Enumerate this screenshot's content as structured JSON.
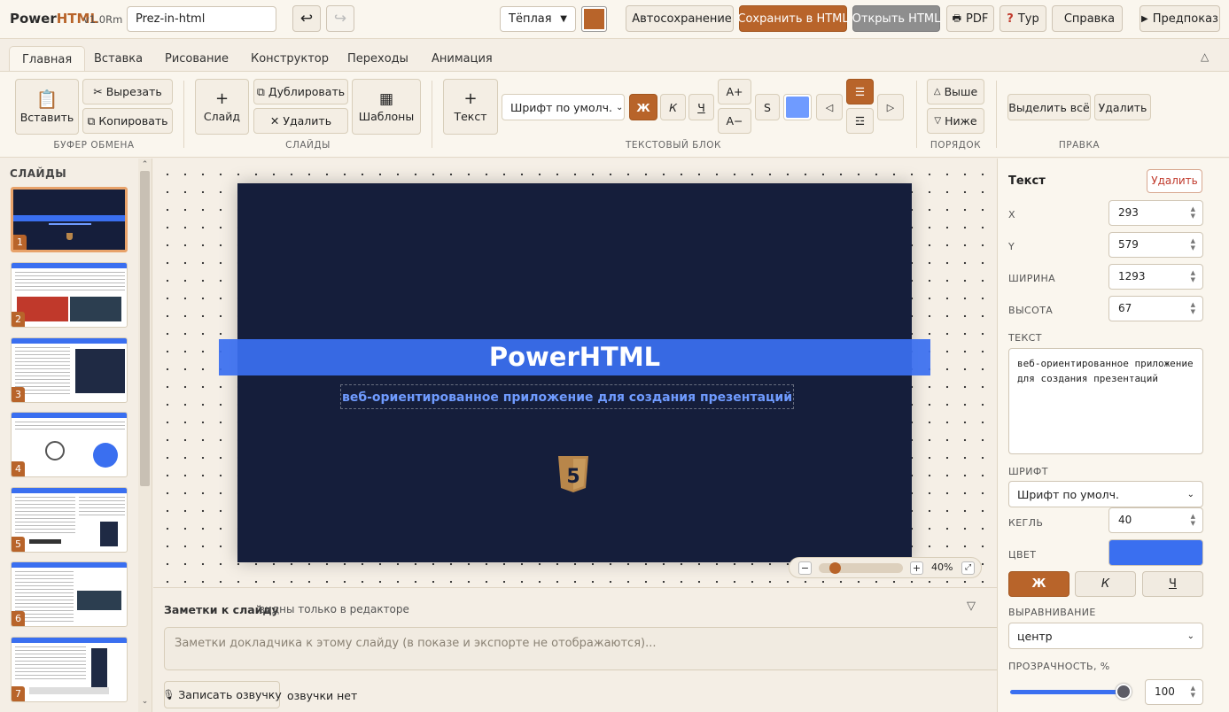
{
  "app": {
    "brand_a": "Power",
    "brand_b": "HTML",
    "version": "v1.0Rm",
    "file_name": "Prez-in-html"
  },
  "toolbar": {
    "theme": "Тёплая",
    "accent_color": "#b8642a",
    "autosave": "Автосохранение",
    "save_html": "Сохранить в HTML",
    "open_html": "Открыть HTML",
    "pdf": "PDF",
    "tour": "Тур",
    "help": "Справка",
    "preview": "Предпоказ"
  },
  "tabs": [
    "Главная",
    "Вставка",
    "Рисование",
    "Конструктор",
    "Переходы",
    "Анимация"
  ],
  "ribbon": {
    "paste": "Вставить",
    "cut": "Вырезать",
    "copy": "Копировать",
    "group_clipboard": "БУФЕР ОБМЕНА",
    "slide": "Слайд",
    "duplicate": "Дублировать",
    "delete": "Удалить",
    "templates": "Шаблоны",
    "group_slides": "СЛАЙДЫ",
    "text": "Текст",
    "font_select": "Шрифт по умолч.",
    "bold": "Ж",
    "italic": "К",
    "underline": "Ч",
    "font_up": "A+",
    "font_down": "A−",
    "strike": "S",
    "group_text": "ТЕКСТОВЫЙ БЛОК",
    "up": "Выше",
    "down": "Ниже",
    "group_order": "ПОРЯДОК",
    "select_all": "Выделить всё",
    "delete_sel": "Удалить",
    "group_edit": "ПРАВКА"
  },
  "slides_panel": {
    "title": "СЛАЙДЫ",
    "count_numbers": [
      "1",
      "2",
      "3",
      "4",
      "5",
      "6",
      "7"
    ]
  },
  "slide": {
    "title": "PowerHTML",
    "subtitle": "веб-ориентированное приложение для создания презентаций",
    "bg_color": "#151e3b",
    "band_color": "#3a6ff0"
  },
  "zoom": {
    "minus": "−",
    "plus": "+",
    "value": "40%",
    "level": 0.15
  },
  "notes": {
    "title": "Заметки к слайду",
    "hint": "видны только в редакторе",
    "placeholder": "Заметки докладчика к этому слайду (в показе и экспорте не отображаются)...",
    "record": "Записать озвучку",
    "status": "озвучки нет"
  },
  "props": {
    "heading": "Текст",
    "delete": "Удалить",
    "x_label": "X",
    "x": "293",
    "y_label": "Y",
    "y": "579",
    "w_label": "ШИРИНА",
    "w": "1293",
    "h_label": "ВЫСОТА",
    "h": "67",
    "text_label": "ТЕКСТ",
    "text": "веб-ориентированное приложение для создания презентаций",
    "font_label": "ШРИФТ",
    "font": "Шрифт по умолч.",
    "size_label": "КЕГЛЬ",
    "size": "40",
    "color_label": "ЦВЕТ",
    "color": "#3a6ff0",
    "bold": "Ж",
    "italic": "К",
    "underline": "Ч",
    "align_label": "ВЫРАВНИВАНИЕ",
    "align": "центр",
    "opacity_label": "ПРОЗРАЧНОСТЬ, %",
    "opacity": "100",
    "opacity_level": 1.0
  }
}
